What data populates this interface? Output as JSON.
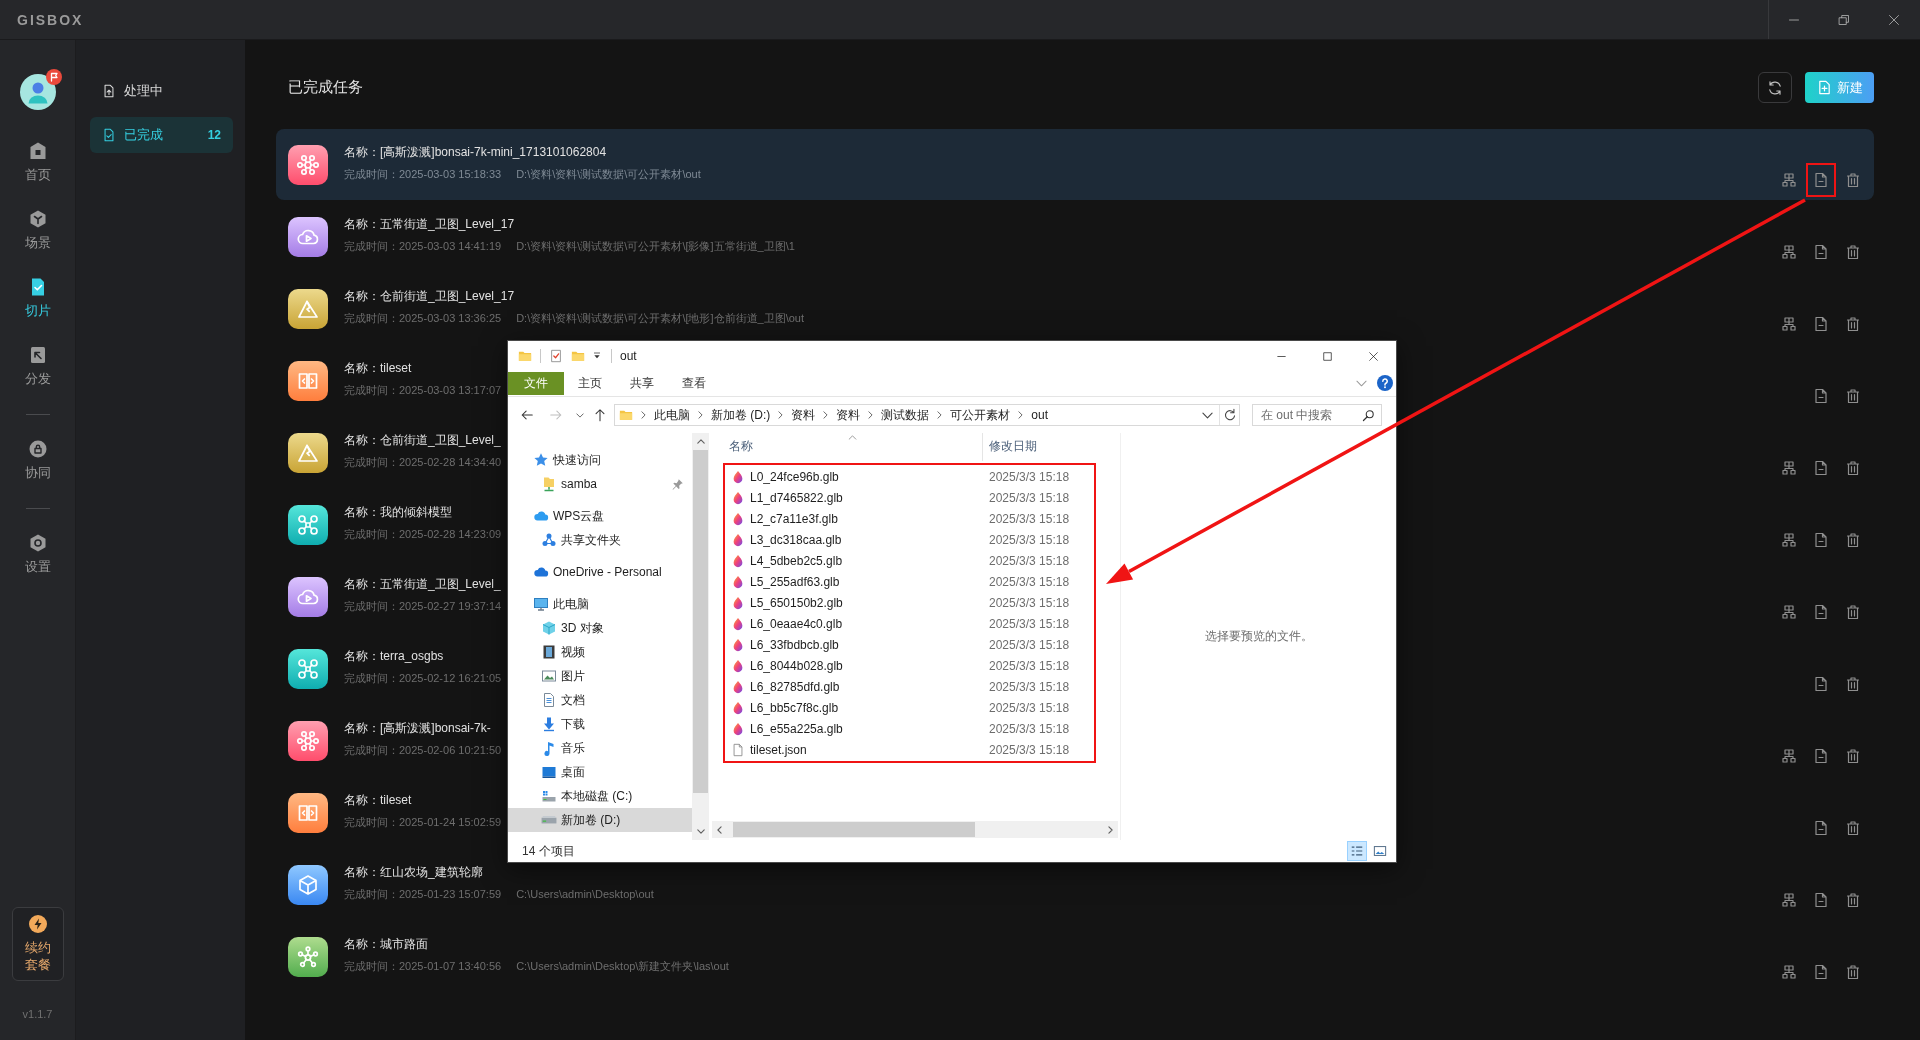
{
  "title_bar": {
    "logo": "GISBOX"
  },
  "rail": {
    "groups": [
      {
        "items": [
          {
            "label": "首页",
            "kind": "home",
            "selected": false
          },
          {
            "label": "场景",
            "kind": "scene",
            "selected": false
          },
          {
            "label": "切片",
            "kind": "slice",
            "selected": true
          },
          {
            "label": "分发",
            "kind": "distribute",
            "selected": false
          }
        ]
      },
      {
        "items": [
          {
            "label": "协同",
            "kind": "collab",
            "selected": false
          }
        ]
      },
      {
        "items": [
          {
            "label": "设置",
            "kind": "settings",
            "selected": false
          }
        ]
      }
    ],
    "renew": "续约套餐",
    "version": "v1.1.7"
  },
  "subnav": {
    "items": [
      {
        "label": "处理中",
        "kind": "processing",
        "selected": false
      },
      {
        "label": "已完成",
        "kind": "done",
        "count": "12",
        "selected": true
      }
    ]
  },
  "main": {
    "title": "已完成任务",
    "new_button": "新建"
  },
  "tasks": [
    {
      "kind": "splat",
      "name": "名称：[高斯泼溅]bonsai-7k-mini_1713101062804",
      "time": "完成时间：2025-03-03 15:18:33",
      "path": "D:\\资料\\资料\\测试数据\\可公开素材\\out",
      "selected": true,
      "actions": [
        {
          "kind": "tree",
          "marked": false
        },
        {
          "kind": "file",
          "marked": true
        },
        {
          "kind": "trash",
          "marked": false
        }
      ]
    },
    {
      "kind": "imagery",
      "name": "名称：五常街道_卫图_Level_17",
      "time": "完成时间：2025-03-03 14:41:19",
      "path": "D:\\资料\\资料\\测试数据\\可公开素材\\[影像]五常街道_卫图\\1",
      "selected": false,
      "actions": [
        {
          "kind": "tree",
          "marked": false
        },
        {
          "kind": "file",
          "marked": false
        },
        {
          "kind": "trash",
          "marked": false
        }
      ]
    },
    {
      "kind": "terrain",
      "name": "名称：仓前街道_卫图_Level_17",
      "time": "完成时间：2025-03-03 13:36:25",
      "path": "D:\\资料\\资料\\测试数据\\可公开素材\\[地形]仓前街道_卫图\\out",
      "selected": false,
      "actions": [
        {
          "kind": "tree",
          "marked": false
        },
        {
          "kind": "file",
          "marked": false
        },
        {
          "kind": "trash",
          "marked": false
        }
      ]
    },
    {
      "kind": "tileset",
      "name": "名称：tileset",
      "time": "完成时间：2025-03-03 13:17:07",
      "selected": false,
      "actions": [
        {
          "kind": "file",
          "marked": false
        },
        {
          "kind": "trash",
          "marked": false
        }
      ]
    },
    {
      "kind": "terrain",
      "name": "名称：仓前街道_卫图_Level_",
      "time": "完成时间：2025-02-28 14:34:40",
      "selected": false,
      "actions": [
        {
          "kind": "tree",
          "marked": false
        },
        {
          "kind": "file",
          "marked": false
        },
        {
          "kind": "trash",
          "marked": false
        }
      ]
    },
    {
      "kind": "oblique",
      "name": "名称：我的倾斜模型",
      "time": "完成时间：2025-02-28 14:23:09",
      "selected": false,
      "actions": [
        {
          "kind": "tree",
          "marked": false
        },
        {
          "kind": "file",
          "marked": false
        },
        {
          "kind": "trash",
          "marked": false
        }
      ]
    },
    {
      "kind": "imagery",
      "name": "名称：五常街道_卫图_Level_",
      "time": "完成时间：2025-02-27 19:37:14",
      "selected": false,
      "actions": [
        {
          "kind": "tree",
          "marked": false
        },
        {
          "kind": "file",
          "marked": false
        },
        {
          "kind": "trash",
          "marked": false
        }
      ]
    },
    {
      "kind": "oblique",
      "name": "名称：terra_osgbs",
      "time": "完成时间：2025-02-12 16:21:05",
      "selected": false,
      "actions": [
        {
          "kind": "file",
          "marked": false
        },
        {
          "kind": "trash",
          "marked": false
        }
      ]
    },
    {
      "kind": "splat",
      "name": "名称：[高斯泼溅]bonsai-7k-",
      "time": "完成时间：2025-02-06 10:21:50",
      "selected": false,
      "actions": [
        {
          "kind": "tree",
          "marked": false
        },
        {
          "kind": "file",
          "marked": false
        },
        {
          "kind": "trash",
          "marked": false
        }
      ]
    },
    {
      "kind": "tileset",
      "name": "名称：tileset",
      "time": "完成时间：2025-01-24 15:02:59",
      "selected": false,
      "actions": [
        {
          "kind": "file",
          "marked": false
        },
        {
          "kind": "trash",
          "marked": false
        }
      ]
    },
    {
      "kind": "model",
      "name": "名称：红山农场_建筑轮廓",
      "time": "完成时间：2025-01-23 15:07:59",
      "path": "C:\\Users\\admin\\Desktop\\out",
      "selected": false,
      "actions": [
        {
          "kind": "tree",
          "marked": false
        },
        {
          "kind": "file",
          "marked": false
        },
        {
          "kind": "trash",
          "marked": false
        }
      ]
    },
    {
      "kind": "pointcloud",
      "name": "名称：城市路面",
      "time": "完成时间：2025-01-07 13:40:56",
      "path": "C:\\Users\\admin\\Desktop\\新建文件夹\\las\\out",
      "selected": false,
      "actions": [
        {
          "kind": "tree",
          "marked": false
        },
        {
          "kind": "file",
          "marked": false
        },
        {
          "kind": "trash",
          "marked": false
        }
      ]
    }
  ],
  "explorer": {
    "title": "out",
    "ribbon": [
      {
        "label": "文件",
        "kind": "menu"
      },
      {
        "label": "主页",
        "kind": "tab"
      },
      {
        "label": "共享",
        "kind": "tab"
      },
      {
        "label": "查看",
        "kind": "tab"
      }
    ],
    "breadcrumb": [
      "此电脑",
      "新加卷 (D:)",
      "资料",
      "资料",
      "测试数据",
      "可公开素材",
      "out"
    ],
    "search": {
      "placeholder": "在 out 中搜索"
    },
    "nav": [
      {
        "label": "快速访问",
        "kind": "star",
        "selected": false,
        "children": [
          {
            "label": "samba",
            "kind": "net-folder",
            "selected": false,
            "pinned": true
          }
        ]
      },
      {
        "label": "WPS云盘",
        "kind": "cloud-wps",
        "selected": false,
        "children": [
          {
            "label": "共享文件夹",
            "kind": "share",
            "selected": false
          }
        ]
      },
      {
        "label": "OneDrive - Personal",
        "kind": "cloud",
        "selected": false
      },
      {
        "label": "此电脑",
        "kind": "pc",
        "selected": false,
        "children": [
          {
            "label": "3D 对象",
            "kind": "cube",
            "selected": false
          },
          {
            "label": "视频",
            "kind": "film",
            "selected": false
          },
          {
            "label": "图片",
            "kind": "picture",
            "selected": false
          },
          {
            "label": "文档",
            "kind": "doc",
            "selected": false
          },
          {
            "label": "下载",
            "kind": "download",
            "selected": false
          },
          {
            "label": "音乐",
            "kind": "music",
            "selected": false
          },
          {
            "label": "桌面",
            "kind": "desktop",
            "selected": false
          },
          {
            "label": "本地磁盘 (C:)",
            "kind": "drive-c",
            "selected": false
          },
          {
            "label": "新加卷 (D:)",
            "kind": "drive",
            "selected": true
          }
        ]
      }
    ],
    "file_list": {
      "columns": [
        {
          "label": "名称",
          "sorted": true
        },
        {
          "label": "修改日期",
          "sorted": false
        }
      ],
      "marked": true,
      "files": [
        {
          "name": "L0_24fce96b.glb",
          "kind": "glb",
          "date": "2025/3/3 15:18"
        },
        {
          "name": "L1_d7465822.glb",
          "kind": "glb",
          "date": "2025/3/3 15:18"
        },
        {
          "name": "L2_c7a11e3f.glb",
          "kind": "glb",
          "date": "2025/3/3 15:18"
        },
        {
          "name": "L3_dc318caa.glb",
          "kind": "glb",
          "date": "2025/3/3 15:18"
        },
        {
          "name": "L4_5dbeb2c5.glb",
          "kind": "glb",
          "date": "2025/3/3 15:18"
        },
        {
          "name": "L5_255adf63.glb",
          "kind": "glb",
          "date": "2025/3/3 15:18"
        },
        {
          "name": "L5_650150b2.glb",
          "kind": "glb",
          "date": "2025/3/3 15:18"
        },
        {
          "name": "L6_0eaae4c0.glb",
          "kind": "glb",
          "date": "2025/3/3 15:18"
        },
        {
          "name": "L6_33fbdbcb.glb",
          "kind": "glb",
          "date": "2025/3/3 15:18"
        },
        {
          "name": "L6_8044b028.glb",
          "kind": "glb",
          "date": "2025/3/3 15:18"
        },
        {
          "name": "L6_82785dfd.glb",
          "kind": "glb",
          "date": "2025/3/3 15:18"
        },
        {
          "name": "L6_bb5c7f8c.glb",
          "kind": "glb",
          "date": "2025/3/3 15:18"
        },
        {
          "name": "L6_e55a225a.glb",
          "kind": "glb",
          "date": "2025/3/3 15:18"
        },
        {
          "name": "tileset.json",
          "kind": "json",
          "date": "2025/3/3 15:18"
        }
      ]
    },
    "preview": "选择要预览的文件。",
    "status": "14 个项目",
    "views": [
      {
        "kind": "details",
        "selected": true
      },
      {
        "kind": "large_icons",
        "selected": false
      }
    ]
  }
}
